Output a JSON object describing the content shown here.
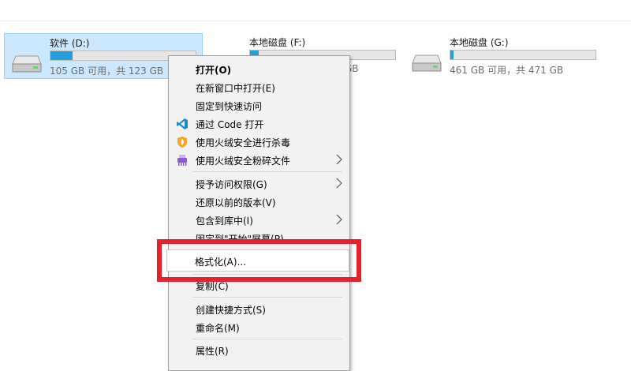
{
  "drives": [
    {
      "name": "软件 (D:)",
      "info": "105 GB 可用，共 123 GB",
      "used_fraction": 0.15,
      "selected": true
    },
    {
      "name": "本地磁盘 (F:)",
      "info": "GB",
      "used_fraction": 0.06,
      "selected": false
    },
    {
      "name": "本地磁盘 (G:)",
      "info": "461 GB 可用，共 471 GB",
      "used_fraction": 0.02,
      "selected": false
    }
  ],
  "context_menu": {
    "items": [
      {
        "label": "打开(O)",
        "bold": true
      },
      {
        "label": "在新窗口中打开(E)"
      },
      {
        "label": "固定到快速访问"
      },
      {
        "label": "通过 Code 打开",
        "icon": "vscode-icon"
      },
      {
        "label": "使用火绒安全进行杀毒",
        "icon": "huorong-shield-icon"
      },
      {
        "label": "使用火绒安全粉碎文件",
        "icon": "shredder-icon",
        "submenu": true
      },
      {
        "label": "授予访问权限(G)",
        "submenu": true
      },
      {
        "label": "还原以前的版本(V)"
      },
      {
        "label": "包含到库中(I)",
        "submenu": true
      },
      {
        "label": "固定到\"开始\"屏幕(P)"
      },
      {
        "label": "格式化(A)..."
      },
      {
        "label": "复制(C)"
      },
      {
        "label": "创建快捷方式(S)"
      },
      {
        "label": "重命名(M)"
      },
      {
        "label": "属性(R)"
      }
    ]
  },
  "colors": {
    "selection_bg": "#cce8ff",
    "bar_fill": "#26a0da",
    "highlight": "#e8202a"
  }
}
